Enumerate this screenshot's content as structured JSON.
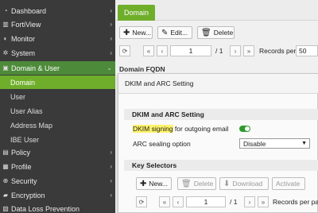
{
  "sidebar": {
    "items": [
      {
        "label": "Dashboard",
        "icon": "dashboard-icon",
        "glyph": "◔"
      },
      {
        "label": "FortiView",
        "icon": "fortiview-icon",
        "glyph": "▥"
      },
      {
        "label": "Monitor",
        "icon": "monitor-icon",
        "glyph": "◐"
      },
      {
        "label": "System",
        "icon": "gear-icon",
        "glyph": "✲"
      },
      {
        "label": "Domain & User",
        "icon": "domain-user-icon",
        "glyph": "▣"
      },
      {
        "label": "Domain"
      },
      {
        "label": "User"
      },
      {
        "label": "User Alias"
      },
      {
        "label": "Address Map"
      },
      {
        "label": "IBE User"
      },
      {
        "label": "Policy",
        "icon": "policy-icon",
        "glyph": "▤"
      },
      {
        "label": "Profile",
        "icon": "profile-icon",
        "glyph": "▦"
      },
      {
        "label": "Security",
        "icon": "security-icon",
        "glyph": "⊕"
      },
      {
        "label": "Encryption",
        "icon": "lock-icon",
        "glyph": "▰"
      },
      {
        "label": "Data Loss Prevention",
        "icon": "dlp-icon",
        "glyph": "▧"
      }
    ]
  },
  "tab": {
    "label": "Domain"
  },
  "toolbar": {
    "new_label": "New...",
    "edit_label": "Edit...",
    "delete_label": "Delete"
  },
  "pager": {
    "page": "1",
    "total": "/ 1",
    "records_label": "Records per page",
    "records_value": "50"
  },
  "table": {
    "column": "Domain FQDN"
  },
  "dialog": {
    "title": "DKIM and ARC Setting",
    "section1": "DKIM and ARC Setting",
    "dkim_highlight": "DKIM signing",
    "dkim_rest": " for outgoing email",
    "arc_label": "ARC sealing option",
    "arc_value": "Disable",
    "section2": "Key Selectors",
    "new_label": "New...",
    "delete_label": "Delete",
    "download_label": "Download",
    "activate_label": "Activate",
    "page": "1",
    "total": "/ 1",
    "records_label": "Records per page"
  },
  "colors": {
    "accent": "#6fae2b",
    "sidebar": "#3a3a3a",
    "toggle_on": "#2e9a2e",
    "highlight": "#fff36b"
  }
}
